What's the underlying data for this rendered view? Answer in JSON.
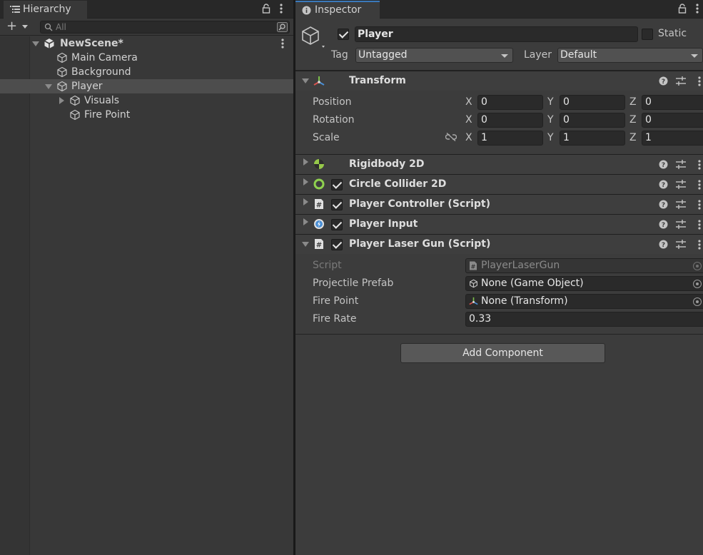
{
  "hierarchy": {
    "tab_label": "Hierarchy",
    "search_placeholder": "All",
    "scene_name": "NewScene*",
    "items": [
      {
        "label": "Main Camera"
      },
      {
        "label": "Background"
      },
      {
        "label": "Player"
      },
      {
        "label": "Visuals"
      },
      {
        "label": "Fire Point"
      }
    ]
  },
  "inspector": {
    "tab_label": "Inspector",
    "object_name": "Player",
    "static_label": "Static",
    "tag_label": "Tag",
    "tag_value": "Untagged",
    "layer_label": "Layer",
    "layer_value": "Default",
    "transform": {
      "title": "Transform",
      "position_label": "Position",
      "rotation_label": "Rotation",
      "scale_label": "Scale",
      "axis_x": "X",
      "axis_y": "Y",
      "axis_z": "Z",
      "position": {
        "x": "0",
        "y": "0",
        "z": "0"
      },
      "rotation": {
        "x": "0",
        "y": "0",
        "z": "0"
      },
      "scale": {
        "x": "1",
        "y": "1",
        "z": "1"
      }
    },
    "components": [
      {
        "title": "Rigidbody 2D"
      },
      {
        "title": "Circle Collider 2D"
      },
      {
        "title": "Player Controller (Script)"
      },
      {
        "title": "Player Input"
      },
      {
        "title": "Player Laser Gun (Script)"
      }
    ],
    "laser_gun": {
      "script_label": "Script",
      "script_value": "PlayerLaserGun",
      "projectile_label": "Projectile Prefab",
      "projectile_value": "None (Game Object)",
      "fire_point_label": "Fire Point",
      "fire_point_value": "None (Transform)",
      "fire_rate_label": "Fire Rate",
      "fire_rate_value": "0.33"
    },
    "add_component_label": "Add Component"
  },
  "colors": {
    "accent": "#3a79bb",
    "transform_icon": "#7cbf4a",
    "rigidbody_icon": "#96c84a",
    "collider_icon": "#8fd14f",
    "input_icon": "#4a8fd6"
  }
}
